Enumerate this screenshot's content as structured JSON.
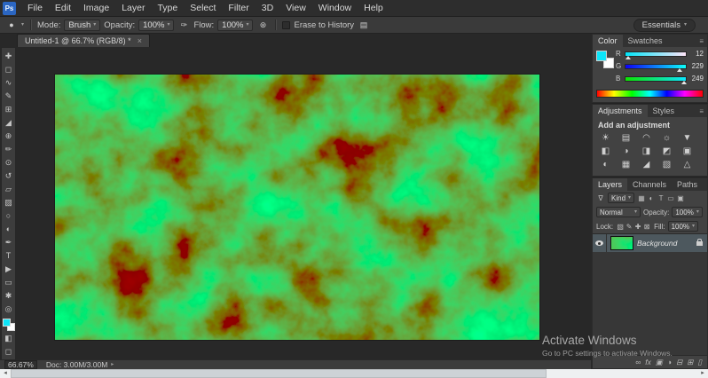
{
  "app": {
    "logo": "Ps"
  },
  "ui": {
    "caret": "▾",
    "menu_icon": "≡",
    "arrow_right": "▸",
    "scroll_left": "◂",
    "scroll_right": "▸",
    "brush_preview": "●",
    "pressure_icon": "✑",
    "airbrush_icon": "⊛",
    "brush_panel_icon": "▤",
    "filter_funnel_icon": "∇"
  },
  "menu": {
    "items": [
      "File",
      "Edit",
      "Image",
      "Layer",
      "Type",
      "Select",
      "Filter",
      "3D",
      "View",
      "Window",
      "Help"
    ]
  },
  "options": {
    "mode_label": "Mode:",
    "mode_value": "Brush",
    "opacity_label": "Opacity:",
    "opacity_value": "100%",
    "flow_label": "Flow:",
    "flow_value": "100%",
    "erase_label": "Erase to History",
    "workspace": "Essentials"
  },
  "document": {
    "tab_title": "Untitled-1 @ 66.7% (RGB/8) *",
    "close": "×"
  },
  "tools": [
    {
      "name": "move-tool",
      "glyph": "✚"
    },
    {
      "name": "marquee-tool",
      "glyph": "◻"
    },
    {
      "name": "lasso-tool",
      "glyph": "∿"
    },
    {
      "name": "quick-selection-tool",
      "glyph": "✎"
    },
    {
      "name": "crop-tool",
      "glyph": "⊞"
    },
    {
      "name": "eyedropper-tool",
      "glyph": "◢"
    },
    {
      "name": "healing-brush-tool",
      "glyph": "⊕"
    },
    {
      "name": "brush-tool",
      "glyph": "✏"
    },
    {
      "name": "clone-stamp-tool",
      "glyph": "⊙"
    },
    {
      "name": "history-brush-tool",
      "glyph": "↺"
    },
    {
      "name": "eraser-tool",
      "glyph": "▱"
    },
    {
      "name": "gradient-tool",
      "glyph": "▨"
    },
    {
      "name": "blur-tool",
      "glyph": "○"
    },
    {
      "name": "dodge-tool",
      "glyph": "◐"
    },
    {
      "name": "pen-tool",
      "glyph": "✒"
    },
    {
      "name": "type-tool",
      "glyph": "T"
    },
    {
      "name": "path-selection-tool",
      "glyph": "▶"
    },
    {
      "name": "shape-tool",
      "glyph": "▭"
    },
    {
      "name": "hand-tool",
      "glyph": "✱"
    },
    {
      "name": "zoom-tool",
      "glyph": "◎"
    }
  ],
  "tools_extra": [
    {
      "name": "quick-mask-button",
      "glyph": "◧"
    },
    {
      "name": "screen-mode-button",
      "glyph": "◻"
    }
  ],
  "color_panel": {
    "tabs": [
      "Color",
      "Swatches"
    ],
    "foreground_color": "#0CE5F9",
    "background_color": "#FFFFFF",
    "channels": [
      {
        "label": "R",
        "value": "12"
      },
      {
        "label": "G",
        "value": "229"
      },
      {
        "label": "B",
        "value": "249"
      }
    ]
  },
  "adjustments_panel": {
    "tabs": [
      "Adjustments",
      "Styles"
    ],
    "title": "Add an adjustment",
    "icons": [
      {
        "name": "brightness-contrast-adjustment-icon",
        "glyph": "☀"
      },
      {
        "name": "levels-adjustment-icon",
        "glyph": "▤"
      },
      {
        "name": "curves-adjustment-icon",
        "glyph": "◠"
      },
      {
        "name": "exposure-adjustment-icon",
        "glyph": "☼"
      },
      {
        "name": "vibrance-adjustment-icon",
        "glyph": "▼"
      },
      {
        "name": "hue-saturation-adjustment-icon",
        "glyph": "◧"
      },
      {
        "name": "color-balance-adjustment-icon",
        "glyph": "◑"
      },
      {
        "name": "black-white-adjustment-icon",
        "glyph": "◨"
      },
      {
        "name": "photo-filter-adjustment-icon",
        "glyph": "◩"
      },
      {
        "name": "channel-mixer-adjustment-icon",
        "glyph": "▣"
      },
      {
        "name": "color-lookup-adjustment-icon",
        "glyph": "◐"
      },
      {
        "name": "invert-adjustment-icon",
        "glyph": "▦"
      },
      {
        "name": "posterize-adjustment-icon",
        "glyph": "◢"
      },
      {
        "name": "threshold-adjustment-icon",
        "glyph": "▧"
      },
      {
        "name": "gradient-map-adjustment-icon",
        "glyph": "△"
      }
    ]
  },
  "layers_panel": {
    "tabs": [
      "Layers",
      "Channels",
      "Paths"
    ],
    "filter_label": "Kind",
    "filter_icons": [
      {
        "name": "filter-pixel-layers-icon",
        "glyph": "▦"
      },
      {
        "name": "filter-adjustment-layers-icon",
        "glyph": "◐"
      },
      {
        "name": "filter-type-layers-icon",
        "glyph": "T"
      },
      {
        "name": "filter-shape-layers-icon",
        "glyph": "▭"
      },
      {
        "name": "filter-smart-objects-icon",
        "glyph": "▣"
      }
    ],
    "blend_mode": "Normal",
    "opacity_label": "Opacity:",
    "opacity_value": "100%",
    "lock_label": "Lock:",
    "lock_icons": [
      {
        "name": "lock-transparency-icon",
        "glyph": "▧"
      },
      {
        "name": "lock-pixels-icon",
        "glyph": "✎"
      },
      {
        "name": "lock-position-icon",
        "glyph": "✚"
      },
      {
        "name": "lock-all-icon",
        "glyph": "⊠"
      }
    ],
    "fill_label": "Fill:",
    "fill_value": "100%",
    "layers": [
      {
        "name": "Background"
      }
    ],
    "footer_icons": [
      {
        "name": "link-layers-icon",
        "glyph": "∞"
      },
      {
        "name": "layer-effects-icon",
        "glyph": "fx"
      },
      {
        "name": "add-layer-mask-icon",
        "glyph": "▣"
      },
      {
        "name": "new-adjustment-layer-icon",
        "glyph": "◑"
      },
      {
        "name": "new-group-icon",
        "glyph": "⊟"
      },
      {
        "name": "new-layer-icon",
        "glyph": "⊞"
      },
      {
        "name": "delete-layer-icon",
        "glyph": "▯"
      }
    ]
  },
  "status": {
    "zoom": "66.67%",
    "doc_label": "Doc: 3.00M/3.00M"
  },
  "watermark": {
    "line1": "Activate Windows",
    "line2": "Go to PC settings to activate Windows."
  }
}
